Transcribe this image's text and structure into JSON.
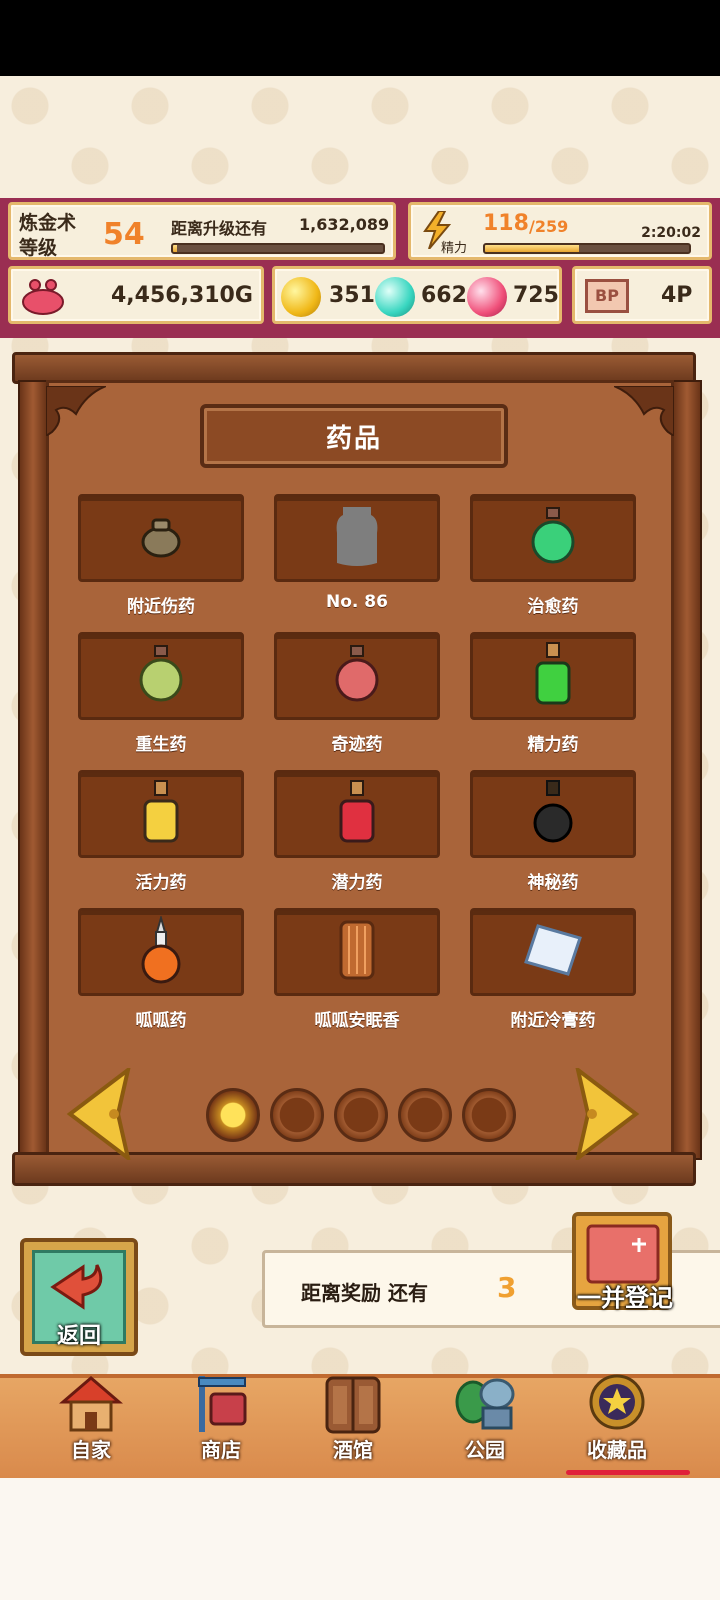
{
  "hud": {
    "level_title": "炼金术\n等级",
    "level": "54",
    "next_level_label": "距离升级还有",
    "next_level_value": "1,632,089",
    "level_progress": 0.02,
    "energy_label": "精力",
    "energy_current": "118",
    "energy_max": "/259",
    "energy_progress": 0.46,
    "energy_timer": "2:20:02",
    "gold": "4,456,310G",
    "gem_yellow": "351",
    "gem_cyan": "662",
    "gem_pink": "725",
    "bp_icon_text": "BP",
    "bp": "4P"
  },
  "collection": {
    "title": "药品",
    "items": [
      {
        "name": "附近伤药",
        "icon": "pouch-icon"
      },
      {
        "name": "No. 86",
        "icon": "unknown-item-icon"
      },
      {
        "name": "治愈药",
        "icon": "green-potion-icon"
      },
      {
        "name": "重生药",
        "icon": "olive-potion-icon"
      },
      {
        "name": "奇迹药",
        "icon": "red-potion-icon"
      },
      {
        "name": "精力药",
        "icon": "green-bottle-icon"
      },
      {
        "name": "活力药",
        "icon": "yellow-bottle-icon"
      },
      {
        "name": "潜力药",
        "icon": "red-bottle-icon"
      },
      {
        "name": "神秘药",
        "icon": "black-bottle-icon"
      },
      {
        "name": "呱呱药",
        "icon": "flask-icon"
      },
      {
        "name": "呱呱安眠香",
        "icon": "incense-icon"
      },
      {
        "name": "附近冷膏药",
        "icon": "plaster-icon"
      }
    ],
    "current_page": 1,
    "page_count": 5
  },
  "actions": {
    "return_label": "返回",
    "reward_label": "距离奖励 还有",
    "reward_count": "3",
    "register_label": "一并登记"
  },
  "nav": {
    "items": [
      {
        "label": "自家",
        "icon": "house-icon"
      },
      {
        "label": "商店",
        "icon": "shop-icon"
      },
      {
        "label": "酒馆",
        "icon": "tavern-icon"
      },
      {
        "label": "公园",
        "icon": "park-icon"
      },
      {
        "label": "收藏品",
        "icon": "medal-icon"
      }
    ],
    "active_index": 4
  },
  "colors": {
    "hud_frame": "#9a2e52",
    "accent_orange": "#f0822a",
    "board_wood": "#a9643a",
    "active_underline": "#e0203a"
  }
}
